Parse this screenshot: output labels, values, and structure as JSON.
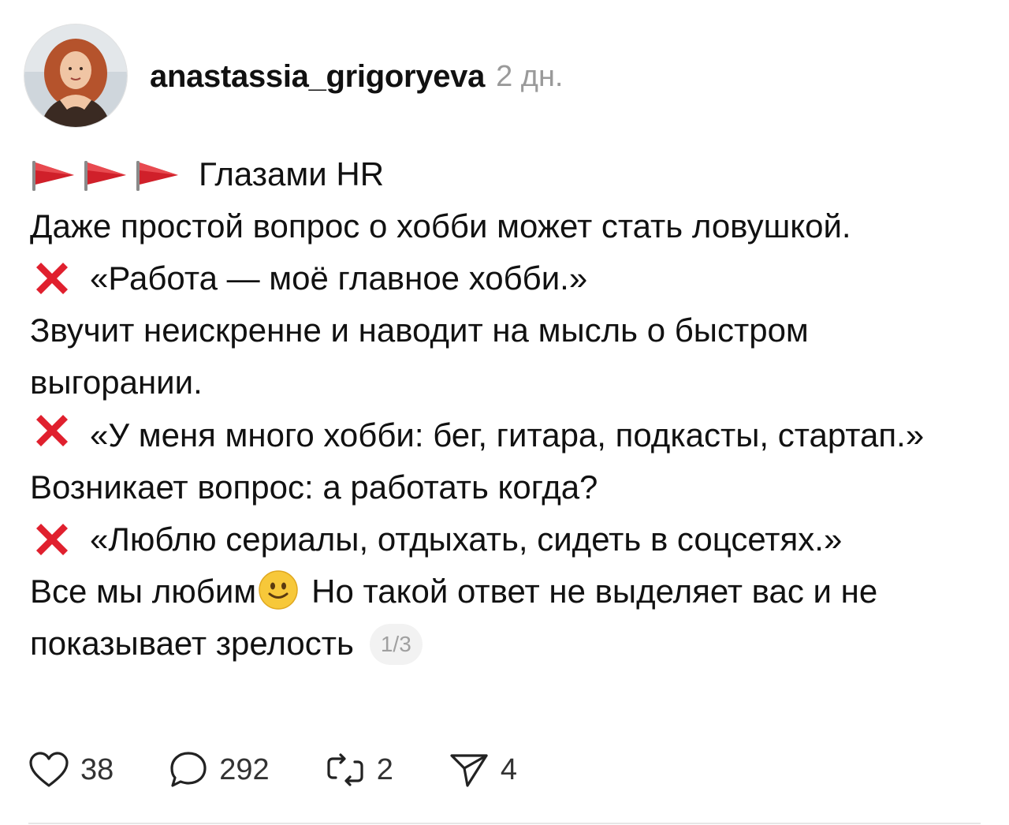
{
  "post": {
    "author": "anastassia_grigoryeva",
    "time": "2 дн.",
    "title": "Глазами HR",
    "intro": "Даже простой вопрос о хобби может стать ловушкой.",
    "item1": "«Работа — моё главное хобби.»",
    "note1": "Звучит неискренне и наводит на мысль о быстром выгорании.",
    "item2": "«У меня много хобби: бег, гитара, подкасты, стартап.»",
    "note2": "Возникает вопрос: а работать когда?",
    "item3": "«Люблю сериалы, отдыхать, сидеть в соцсетях.»",
    "note3_a": "Все мы любим",
    "note3_b": "Но такой ответ не выделяет вас и не показывает зрелость",
    "page_counter": "1/3"
  },
  "actions": {
    "likes": "38",
    "comments": "292",
    "reposts": "2",
    "shares": "4"
  },
  "icons": {
    "flags": "triangular-flag-icon",
    "cross": "cross-mark-icon",
    "smile": "slightly-smiling-face-icon",
    "like": "heart-icon",
    "comment": "speech-bubble-icon",
    "repost": "repost-icon",
    "share": "paper-plane-icon"
  },
  "colors": {
    "flag_red": "#d0202a",
    "cross_red": "#e0202e",
    "muted_text": "#9a9a9a"
  }
}
